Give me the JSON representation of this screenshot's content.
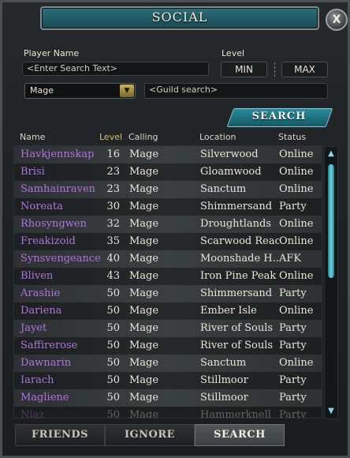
{
  "window": {
    "title": "SOCIAL",
    "close_label": "X"
  },
  "search_form": {
    "player_name_label": "Player Name",
    "player_name_placeholder": "<Enter Search Text>",
    "level_label": "Level",
    "min_label": "MIN",
    "max_label": "MAX",
    "calling_selected": "Mage",
    "guild_placeholder": "<Guild search>",
    "search_button_label": "SEARCH"
  },
  "table": {
    "columns": [
      "Name",
      "Level",
      "Calling",
      "Location",
      "Status"
    ],
    "rows": [
      {
        "name": "Havkjennskap",
        "level": "16",
        "calling": "Mage",
        "location": "Silverwood",
        "status": "Online"
      },
      {
        "name": "Brisi",
        "level": "23",
        "calling": "Mage",
        "location": "Gloamwood",
        "status": "Online"
      },
      {
        "name": "Samhainraven",
        "level": "23",
        "calling": "Mage",
        "location": "Sanctum",
        "status": "Online"
      },
      {
        "name": "Noreata",
        "level": "30",
        "calling": "Mage",
        "location": "Shimmersand",
        "status": "Party"
      },
      {
        "name": "Rhosyngwen",
        "level": "32",
        "calling": "Mage",
        "location": "Droughtlands",
        "status": "Online"
      },
      {
        "name": "Freakizoid",
        "level": "35",
        "calling": "Mage",
        "location": "Scarwood Reach",
        "status": "Online"
      },
      {
        "name": "Synsvengeance",
        "level": "40",
        "calling": "Mage",
        "location": "Moonshade H...",
        "status": "AFK"
      },
      {
        "name": "Bliven",
        "level": "43",
        "calling": "Mage",
        "location": "Iron Pine Peak",
        "status": "Online"
      },
      {
        "name": "Arashie",
        "level": "50",
        "calling": "Mage",
        "location": "Shimmersand",
        "status": "Party"
      },
      {
        "name": "Dariena",
        "level": "50",
        "calling": "Mage",
        "location": "Ember Isle",
        "status": "Online"
      },
      {
        "name": "Jayet",
        "level": "50",
        "calling": "Mage",
        "location": "River of Souls",
        "status": "Party"
      },
      {
        "name": "Saffirerose",
        "level": "50",
        "calling": "Mage",
        "location": "River of Souls",
        "status": "Party"
      },
      {
        "name": "Dawnarin",
        "level": "50",
        "calling": "Mage",
        "location": "Sanctum",
        "status": "Online"
      },
      {
        "name": "Iarach",
        "level": "50",
        "calling": "Mage",
        "location": "Stillmoor",
        "status": "Party"
      },
      {
        "name": "Magliene",
        "level": "50",
        "calling": "Mage",
        "location": "Stillmoor",
        "status": "Party"
      },
      {
        "name": "Niaz",
        "level": "50",
        "calling": "Mage",
        "location": "Hammerknell",
        "status": "Party"
      }
    ]
  },
  "tabs": [
    {
      "label": "FRIENDS",
      "active": false
    },
    {
      "label": "IGNORE",
      "active": false
    },
    {
      "label": "SEARCH",
      "active": true
    }
  ],
  "icons": {
    "close": "close-icon",
    "dropdown": "chevron-down-icon",
    "scroll_up": "chevron-up-icon",
    "scroll_down": "chevron-down-icon"
  },
  "colors": {
    "player_name": "#b271df",
    "accent": "#2a8a9b",
    "level_header": "#d9c06b"
  }
}
